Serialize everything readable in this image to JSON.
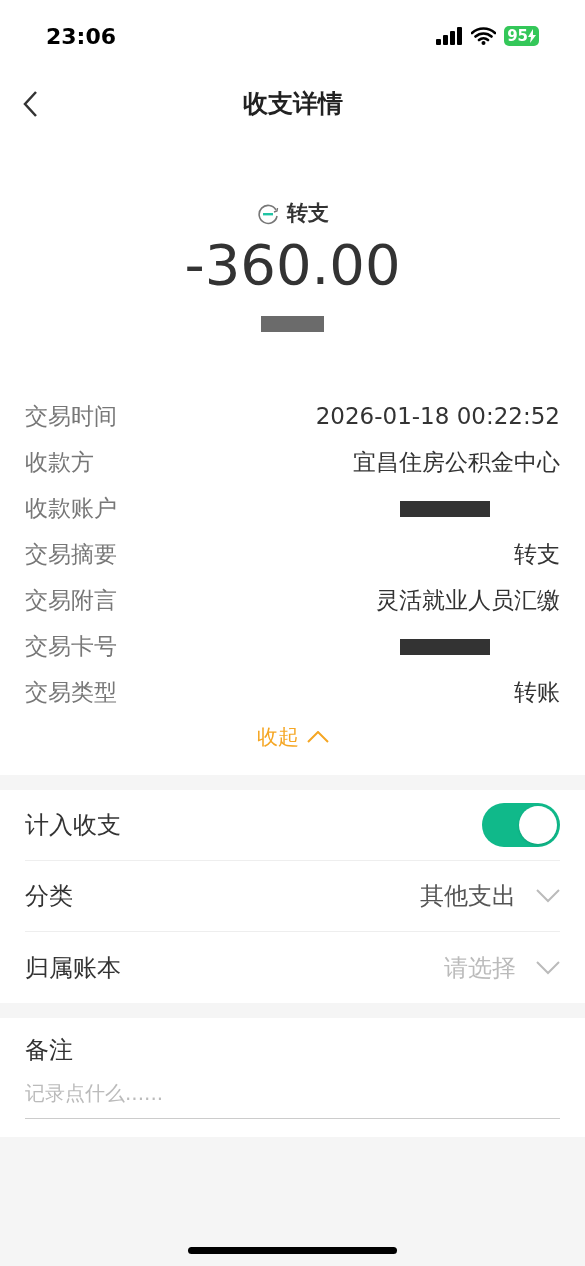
{
  "status_bar": {
    "time": "23:06",
    "battery": "95"
  },
  "header": {
    "title": "收支详情"
  },
  "summary": {
    "type_label": "转支",
    "amount": "-360.00"
  },
  "details": [
    {
      "kind": "text",
      "label": "交易时间",
      "value": "2026-01-18 00:22:52"
    },
    {
      "kind": "text",
      "label": "收款方",
      "value": "宜昌住房公积金中心"
    },
    {
      "kind": "redacted",
      "label": "收款账户"
    },
    {
      "kind": "text",
      "label": "交易摘要",
      "value": "转支"
    },
    {
      "kind": "text",
      "label": "交易附言",
      "value": "灵活就业人员汇缴"
    },
    {
      "kind": "redacted",
      "label": "交易卡号"
    },
    {
      "kind": "text",
      "label": "交易类型",
      "value": "转账"
    }
  ],
  "collapse_link": "收起",
  "settings": [
    {
      "kind": "toggle",
      "label": "计入收支",
      "on": true
    },
    {
      "kind": "select",
      "label": "分类",
      "value": "其他支出"
    },
    {
      "kind": "select",
      "label": "归属账本",
      "placeholder": "请选择"
    }
  ],
  "note": {
    "label": "备注",
    "placeholder": "记录点什么......"
  }
}
